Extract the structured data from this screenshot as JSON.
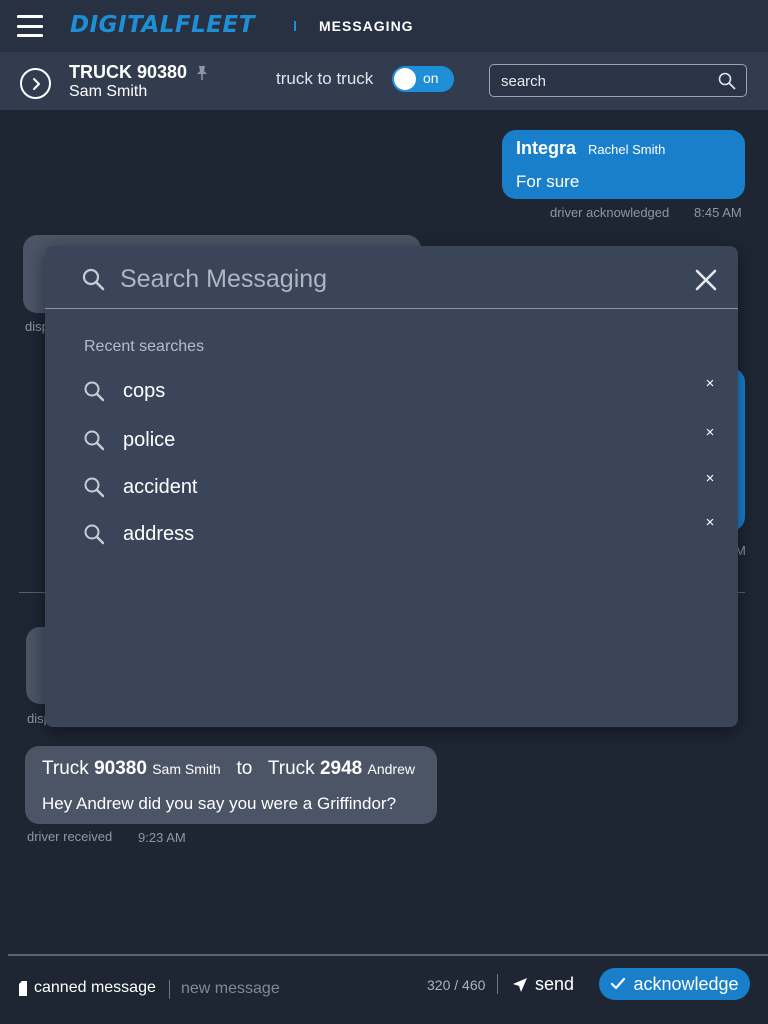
{
  "topbar": {
    "logo": "DIGITALFLEET",
    "section": "MESSAGING"
  },
  "header": {
    "truck_title": "TRUCK 90380",
    "driver": "Sam Smith",
    "truck_to_truck_label": "truck to truck",
    "toggle_label": "on",
    "search_placeholder": "search"
  },
  "messages": [
    {
      "sender": "Integra",
      "sender_sub": "Rachel Smith",
      "body": "For sure",
      "status": "driver acknowledged",
      "time": "8:45 AM"
    },
    {
      "status_partial": "disp"
    },
    {
      "time_partial": "M"
    },
    {
      "status_partial": "disp"
    },
    {
      "from_prefix": "Truck",
      "from_number": "90380",
      "from_name": "Sam Smith",
      "to_word": "to",
      "to_prefix": "Truck",
      "to_number": "2948",
      "to_name": "Andrew",
      "body": "Hey Andrew did you say you were a Griffindor?",
      "status": "driver received",
      "time": "9:23 AM"
    }
  ],
  "search_overlay": {
    "placeholder": "Search Messaging",
    "recent_heading": "Recent searches",
    "recent": [
      "cops",
      "police",
      "accident",
      "address"
    ],
    "remove_glyph": "×"
  },
  "composer": {
    "canned_label": "canned message",
    "new_message_placeholder": "new message",
    "char_count": "320 / 460",
    "send_label": "send",
    "acknowledge_label": "acknowledge"
  },
  "colors": {
    "accent": "#1a7fcb",
    "logo": "#1e8fd6",
    "background": "#1e2634",
    "overlay": "#3a4559"
  }
}
